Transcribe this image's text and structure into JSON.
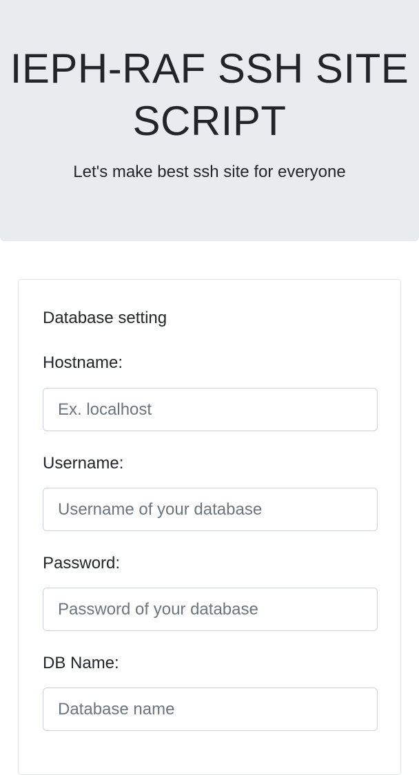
{
  "header": {
    "title": "IEPH-RAF SSH SITE SCRIPT",
    "subtitle": "Let's make best ssh site for everyone"
  },
  "form": {
    "section_title": "Database setting",
    "fields": [
      {
        "label": "Hostname:",
        "placeholder": "Ex. localhost",
        "value": ""
      },
      {
        "label": "Username:",
        "placeholder": "Username of your database",
        "value": ""
      },
      {
        "label": "Password:",
        "placeholder": "Password of your database",
        "value": ""
      },
      {
        "label": "DB Name:",
        "placeholder": "Database name",
        "value": ""
      }
    ]
  },
  "colors": {
    "jumbotron_bg": "#e9ecef",
    "text": "#212529",
    "placeholder": "#6c757d",
    "input_border": "#ced4da"
  }
}
